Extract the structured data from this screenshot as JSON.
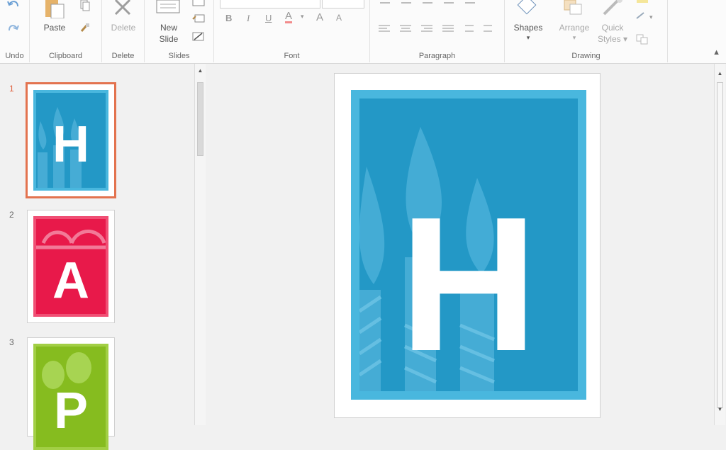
{
  "ribbon": {
    "groups": {
      "undo": "Undo",
      "clipboard": "Clipboard",
      "delete": "Delete",
      "slides": "Slides",
      "font": "Font",
      "paragraph": "Paragraph",
      "drawing": "Drawing"
    },
    "buttons": {
      "paste": "Paste",
      "delete": "Delete",
      "new_slide_line1": "New",
      "new_slide_line2": "Slide",
      "shapes": "Shapes",
      "arrange": "Arrange",
      "quick_styles_line1": "Quick",
      "quick_styles_line2": "Styles",
      "bold": "B",
      "italic": "I",
      "underline": "U",
      "font_color": "A",
      "grow_font": "A",
      "shrink_font": "A"
    }
  },
  "slides": [
    {
      "number": "1",
      "letter": "H",
      "color": "#2398c6",
      "border": "#49b7de"
    },
    {
      "number": "2",
      "letter": "A",
      "color": "#e8194a",
      "border": "#f04f74"
    },
    {
      "number": "3",
      "letter": "P",
      "color": "#86bc1f",
      "border": "#a2cf45"
    }
  ],
  "main_slide": {
    "letter": "H",
    "outer_color": "#49b7de",
    "inner_color": "#2398c6"
  },
  "colors": {
    "accent_selected": "#e3734f",
    "ribbon_bg": "#fbfbfb"
  }
}
